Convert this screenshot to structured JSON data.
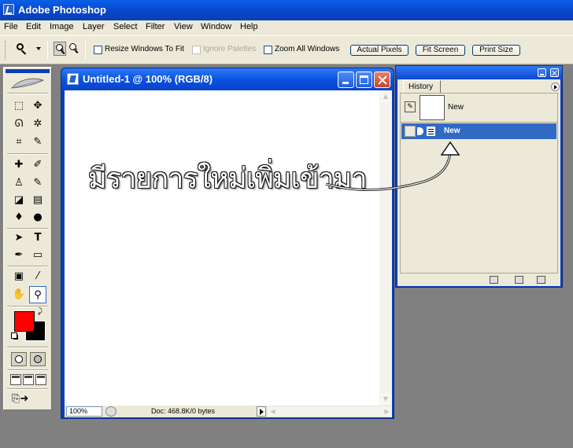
{
  "app": {
    "title": "Adobe Photoshop"
  },
  "menu": [
    "File",
    "Edit",
    "Image",
    "Layer",
    "Select",
    "Filter",
    "View",
    "Window",
    "Help"
  ],
  "options": {
    "tool_icon": "zoom-icon",
    "zoom_in_icon": "zoom-in-icon",
    "zoom_out_icon": "zoom-out-icon",
    "checkboxes": [
      {
        "label": "Resize Windows To Fit",
        "checked": false,
        "enabled": true
      },
      {
        "label": "Ignore Palettes",
        "checked": false,
        "enabled": false
      },
      {
        "label": "Zoom All Windows",
        "checked": false,
        "enabled": true
      }
    ],
    "buttons": [
      "Actual Pixels",
      "Fit Screen",
      "Print Size"
    ]
  },
  "toolbox": {
    "logo": "feather-logo",
    "tools": [
      {
        "icon": "marquee-icon",
        "glyph": "⬚"
      },
      {
        "icon": "move-icon",
        "glyph": "✥"
      },
      {
        "icon": "lasso-icon",
        "glyph": "ᘏ"
      },
      {
        "icon": "magic-wand-icon",
        "glyph": "✲"
      },
      {
        "icon": "crop-icon",
        "glyph": "⌗"
      },
      {
        "icon": "slice-icon",
        "glyph": "✎"
      },
      {
        "icon": "healing-brush-icon",
        "glyph": "✚"
      },
      {
        "icon": "brush-icon",
        "glyph": "✐"
      },
      {
        "icon": "clone-stamp-icon",
        "glyph": "♙"
      },
      {
        "icon": "history-brush-icon",
        "glyph": "✎"
      },
      {
        "icon": "eraser-icon",
        "glyph": "◪"
      },
      {
        "icon": "gradient-icon",
        "glyph": "▤"
      },
      {
        "icon": "blur-icon",
        "glyph": "♦"
      },
      {
        "icon": "dodge-icon",
        "glyph": "●"
      },
      {
        "icon": "path-selection-icon",
        "glyph": "➤"
      },
      {
        "icon": "type-icon",
        "glyph": "T"
      },
      {
        "icon": "pen-icon",
        "glyph": "✒"
      },
      {
        "icon": "rectangle-icon",
        "glyph": "▭"
      },
      {
        "icon": "notes-icon",
        "glyph": "▣"
      },
      {
        "icon": "eyedropper-icon",
        "glyph": "⁄"
      },
      {
        "icon": "hand-icon",
        "glyph": "✋"
      },
      {
        "icon": "zoom-icon",
        "glyph": "⚲"
      }
    ],
    "foreground_color": "#ff0000",
    "background_color": "#000000"
  },
  "document": {
    "title": "Untitled-1 @ 100% (RGB/8)",
    "zoom": "100%",
    "info": "Doc: 468.8K/0 bytes"
  },
  "history": {
    "tab": "History",
    "snapshot_label": "New",
    "state_label": "New"
  },
  "annotation": {
    "text": "มีรายการใหม่เพิ่มเข้ามา"
  },
  "colors": {
    "accent": "#0a3fb8",
    "selection": "#316ac5"
  }
}
